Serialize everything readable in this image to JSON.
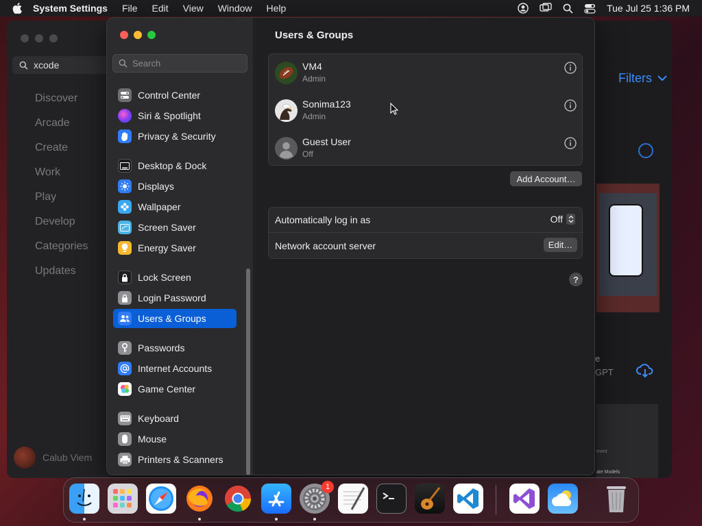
{
  "menubar": {
    "app_name": "System Settings",
    "menus": [
      "File",
      "Edit",
      "View",
      "Window",
      "Help"
    ],
    "clock": "Tue Jul 25  1:36 PM"
  },
  "background_window": {
    "search_value": "xcode",
    "nav": [
      "Discover",
      "Arcade",
      "Create",
      "Work",
      "Play",
      "Develop",
      "Categories",
      "Updates"
    ],
    "user_name": "Calub Viem",
    "filters_label": "Filters",
    "partial_text_1": "e",
    "partial_text_2": "GPT",
    "card_text_1": "ment",
    "card_text_2": "ate Models"
  },
  "sidebar": {
    "search_placeholder": "Search",
    "items": [
      {
        "label": "Control Center",
        "icon": "control-center-icon",
        "color": "#6e6e73"
      },
      {
        "label": "Siri & Spotlight",
        "icon": "siri-icon",
        "color": "#b043d6"
      },
      {
        "label": "Privacy & Security",
        "icon": "hand-icon",
        "color": "#2f7cf6"
      },
      {
        "label": "Desktop & Dock",
        "icon": "desktop-icon",
        "color": "#1c1c1e"
      },
      {
        "label": "Displays",
        "icon": "sun-icon",
        "color": "#2f7cf6"
      },
      {
        "label": "Wallpaper",
        "icon": "flower-icon",
        "color": "#3aa7f0"
      },
      {
        "label": "Screen Saver",
        "icon": "screen-saver-icon",
        "color": "#4bb4e6"
      },
      {
        "label": "Energy Saver",
        "icon": "bulb-icon",
        "color": "#f5b82e"
      },
      {
        "label": "Lock Screen",
        "icon": "lock-icon",
        "color": "#1c1c1e"
      },
      {
        "label": "Login Password",
        "icon": "padlock-icon",
        "color": "#8e8e93"
      },
      {
        "label": "Users & Groups",
        "icon": "users-icon",
        "color": "#2f7cf6"
      },
      {
        "label": "Passwords",
        "icon": "key-icon",
        "color": "#8e8e93"
      },
      {
        "label": "Internet Accounts",
        "icon": "at-icon",
        "color": "#2f7cf6"
      },
      {
        "label": "Game Center",
        "icon": "game-center-icon",
        "color": "#ffffff"
      },
      {
        "label": "Keyboard",
        "icon": "keyboard-icon",
        "color": "#8e8e93"
      },
      {
        "label": "Mouse",
        "icon": "mouse-icon",
        "color": "#8e8e93"
      },
      {
        "label": "Printers & Scanners",
        "icon": "printer-icon",
        "color": "#8e8e93"
      }
    ]
  },
  "content": {
    "title": "Users & Groups",
    "users": [
      {
        "name": "VM4",
        "role": "Admin",
        "avatar": "football-avatar"
      },
      {
        "name": "Sonima123",
        "role": "Admin",
        "avatar": "eagle-avatar"
      },
      {
        "name": "Guest User",
        "role": "Off",
        "avatar": "guest-avatar"
      }
    ],
    "add_account_label": "Add Account…",
    "auto_login_label": "Automatically log in as",
    "auto_login_value": "Off",
    "network_server_label": "Network account server",
    "edit_label": "Edit…",
    "help_label": "?"
  },
  "dock": {
    "settings_badge": "1",
    "apps": [
      "finder-icon",
      "launchpad-icon",
      "safari-icon",
      "firefox-icon",
      "chrome-icon",
      "app-store-icon",
      "system-settings-icon",
      "textedit-icon",
      "terminal-icon",
      "garageband-icon",
      "vscode-icon",
      "visual-studio-icon",
      "weather-icon",
      "trash-icon"
    ]
  },
  "colors": {
    "accent": "#0a5fd6",
    "close": "#ff5f57",
    "minimize": "#febc2e",
    "zoom": "#28c840"
  }
}
